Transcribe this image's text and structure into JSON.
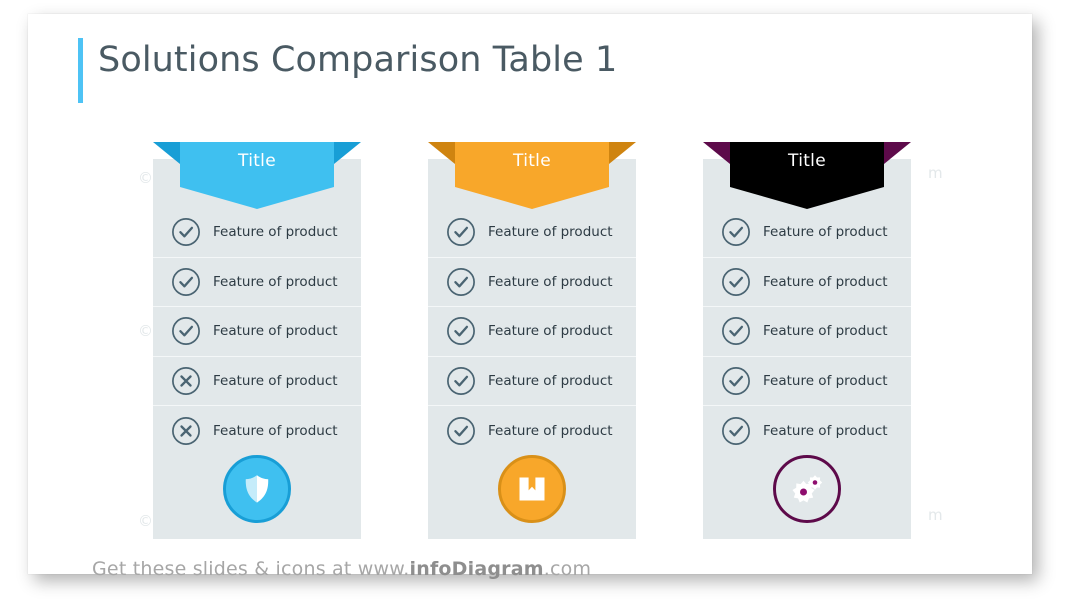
{
  "page": {
    "title": "Solutions Comparison Table 1",
    "accent_color": "#4ec3f5",
    "card_background": "#ffffff",
    "canvas_background": "#ffffff"
  },
  "footer": {
    "prefix": "Get these slides & icons at www.",
    "brand": "infoDiagram",
    "suffix": ".com"
  },
  "watermarks": [
    {
      "text": "©"
    },
    {
      "text": "©"
    },
    {
      "text": "©"
    },
    {
      "text": "m"
    },
    {
      "text": "m"
    }
  ],
  "columns": [
    {
      "title": "Title",
      "color": "#3fc0f0",
      "fold_color": "#189ed6",
      "badge_ring_color": "#189ed6",
      "badge_icon": "shield-icon",
      "panel_color": "#e2e8ea",
      "rows": [
        {
          "label": "Feature of product",
          "icon": "check-circle-icon"
        },
        {
          "label": "Feature of product",
          "icon": "check-circle-icon"
        },
        {
          "label": "Feature of product",
          "icon": "check-circle-icon"
        },
        {
          "label": "Feature of product",
          "icon": "x-circle-icon"
        },
        {
          "label": "Feature of product",
          "icon": "x-circle-icon"
        }
      ]
    },
    {
      "title": "Title",
      "color": "#f8a72a",
      "fold_color": "#cf8410",
      "badge_ring_color": "#d99018",
      "badge_icon": "bookmark-icon",
      "panel_color": "#e2e8ea",
      "rows": [
        {
          "label": "Feature of product",
          "icon": "check-circle-icon"
        },
        {
          "label": "Feature of product",
          "icon": "check-circle-icon"
        },
        {
          "label": "Feature of product",
          "icon": "check-circle-icon"
        },
        {
          "label": "Feature of product",
          "icon": "check-circle-icon"
        },
        {
          "label": "Feature of product",
          "icon": "check-circle-icon"
        }
      ]
    },
    {
      "title": "Title",
      "color": "#8e0d६e",
      "fold_color": "#5d0a4a",
      "badge_ring_color": "#5d0a4a",
      "badge_icon": "gears-icon",
      "panel_color": "#e2e8ea",
      "rows": [
        {
          "label": "Feature of product",
          "icon": "check-circle-icon"
        },
        {
          "label": "Feature of product",
          "icon": "check-circle-icon"
        },
        {
          "label": "Feature of product",
          "icon": "check-circle-icon"
        },
        {
          "label": "Feature of product",
          "icon": "check-circle-icon"
        },
        {
          "label": "Feature of product",
          "icon": "check-circle-icon"
        }
      ]
    }
  ],
  "icon_colors": {
    "row_icon_stroke": "#4a6472",
    "badge_glyph": "#ffffff"
  }
}
